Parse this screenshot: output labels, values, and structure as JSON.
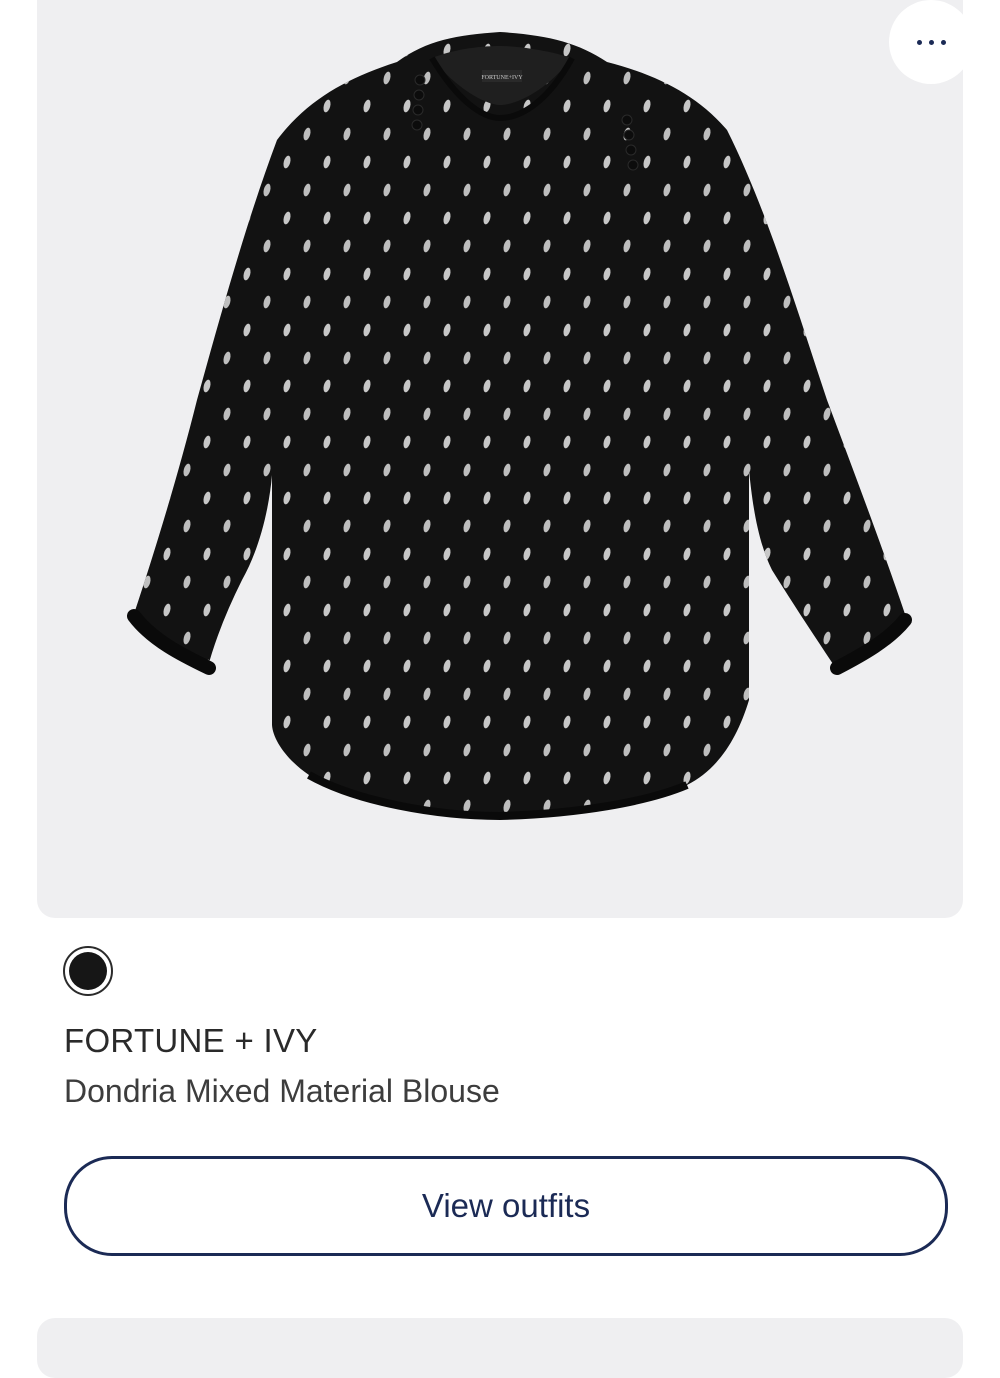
{
  "product_card": {
    "image_alt": "Black blouse with metallic silver print",
    "more_button_label": "more options",
    "color_swatch": {
      "color": "#161616",
      "selected": true
    },
    "brand": "FORTUNE + IVY",
    "name": "Dondria Mixed Material Blouse",
    "view_outfits_label": "View outfits",
    "garment_label": "FORTUNE+IVY"
  },
  "colors": {
    "card_background": "#efeff1",
    "accent": "#1b2a55",
    "garment": "#141414"
  }
}
